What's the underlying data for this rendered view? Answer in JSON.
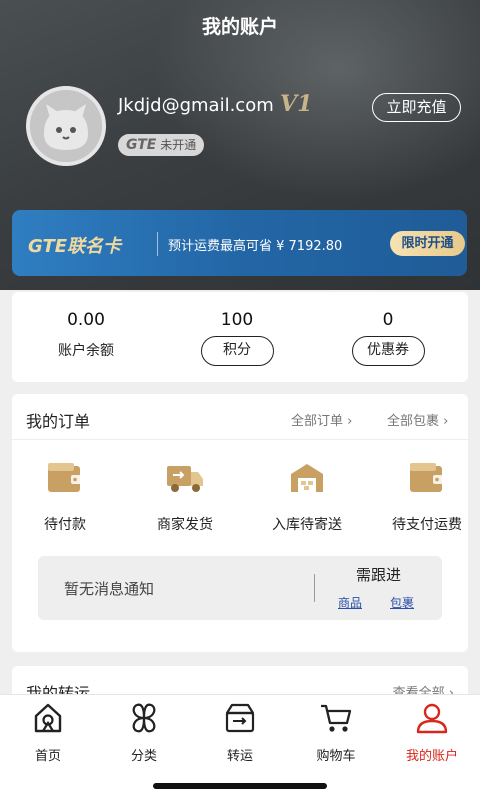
{
  "page_title": "我的账户",
  "profile": {
    "email": "Jkdjd@gmail.com",
    "vip_level": "V1",
    "recharge_label": "立即充值",
    "gte_badge_logo": "GTE",
    "gte_badge_text": "未开通"
  },
  "banner": {
    "title": "GTE联名卡",
    "text": "预计运费最高可省 ¥ 7192.80",
    "button": "限时开通"
  },
  "stats": [
    {
      "value": "0.00",
      "label": "账户余额"
    },
    {
      "value": "100",
      "label": "积分"
    },
    {
      "value": "0",
      "label": "优惠券"
    }
  ],
  "orders": {
    "title": "我的订单",
    "all_orders": "全部订单 ›",
    "all_packages": "全部包裹 ›",
    "items": [
      {
        "label": "待付款",
        "icon": "wallet-icon"
      },
      {
        "label": "商家发货",
        "icon": "truck-icon"
      },
      {
        "label": "入库待寄送",
        "icon": "warehouse-icon"
      },
      {
        "label": "待支付运费",
        "icon": "wallet-icon"
      }
    ],
    "notice": {
      "text": "暂无消息通知",
      "title": "需跟进",
      "link_goods": "商品",
      "link_package": "包裹"
    }
  },
  "transit": {
    "title": "我的转运",
    "view_all": "查看全部 ›"
  },
  "tabbar": [
    {
      "label": "首页",
      "icon": "home-icon"
    },
    {
      "label": "分类",
      "icon": "category-icon"
    },
    {
      "label": "转运",
      "icon": "transit-box-icon"
    },
    {
      "label": "购物车",
      "icon": "cart-icon"
    },
    {
      "label": "我的账户",
      "icon": "user-icon",
      "active": true
    }
  ],
  "colors": {
    "accent_red": "#d9261c",
    "gold": "#c8a064",
    "banner_blue": "#2366a6"
  }
}
